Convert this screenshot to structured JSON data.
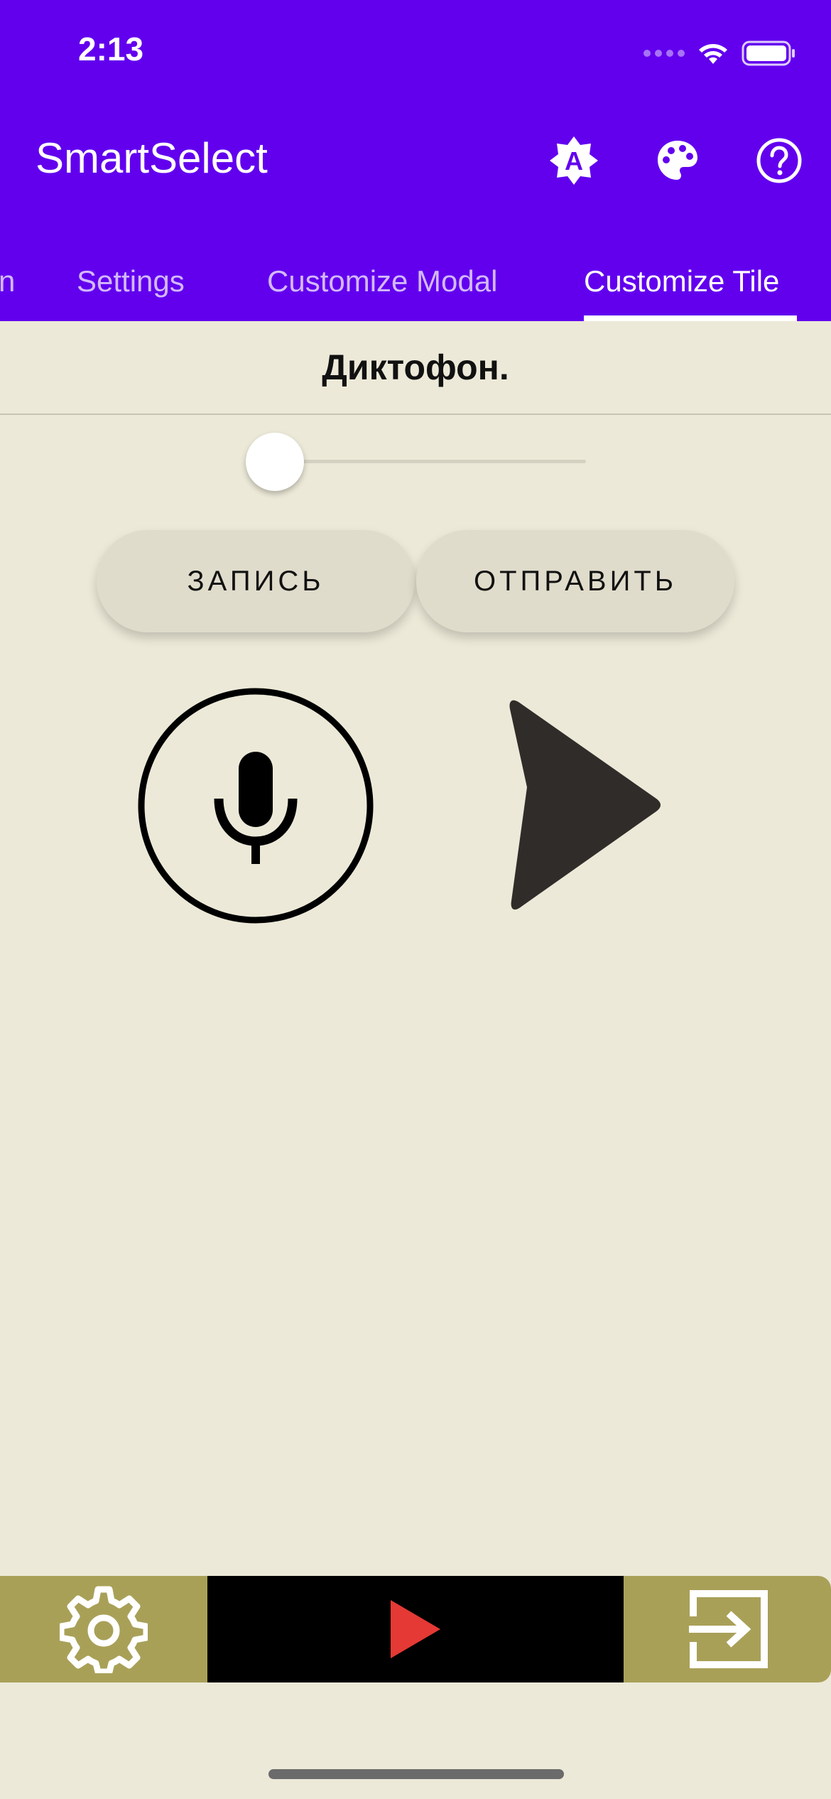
{
  "status_bar": {
    "time": "2:13"
  },
  "app_bar": {
    "title": "SmartSelect",
    "icons": [
      "brightness-auto-icon",
      "palette-icon",
      "help-icon"
    ]
  },
  "tabs": [
    {
      "label": "n",
      "active": false
    },
    {
      "label": "Settings",
      "active": false
    },
    {
      "label": "Customize Modal",
      "active": false
    },
    {
      "label": "Customize Tile",
      "active": true
    }
  ],
  "content": {
    "title": "Диктофон.",
    "slider_value": 0,
    "record_button": "ЗАПИСЬ",
    "send_button": "ОТПРАВИТЬ",
    "icons": [
      "microphone-icon",
      "send-icon"
    ]
  },
  "bottom_bar": {
    "icons": [
      "settings-icon",
      "play-icon",
      "exit-icon"
    ]
  },
  "colors": {
    "primary": "#6200EE",
    "background": "#ECE9D8",
    "bottom_accent": "#A9A058",
    "play": "#E53935"
  }
}
